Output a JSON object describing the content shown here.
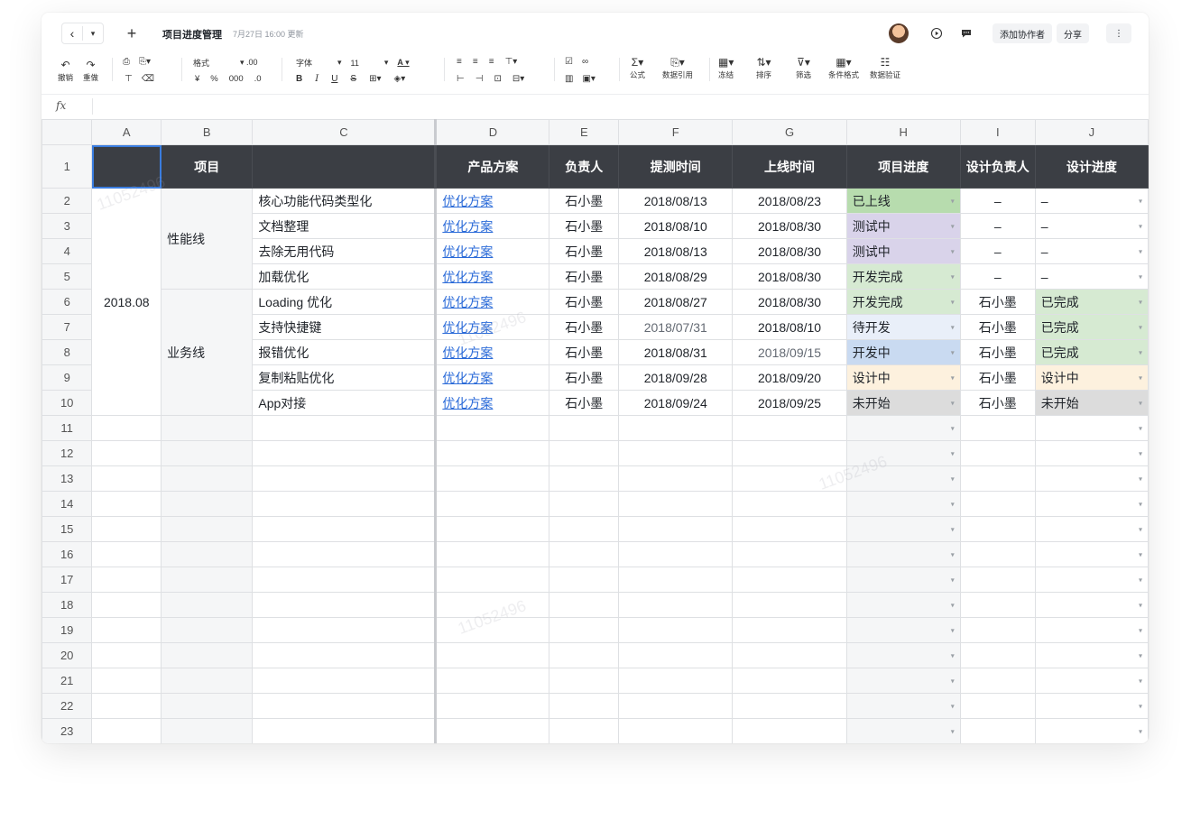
{
  "titlebar": {
    "back_icon": "‹",
    "dropdown_icon": "▾",
    "add_icon": "+",
    "title": "项目进度管理",
    "updated": "7月27日 16:00 更新",
    "add_collaborator": "添加协作者",
    "share": "分享",
    "more_icon": "⋮"
  },
  "toolbar": {
    "undo": "撤销",
    "redo": "重做",
    "format": "格式",
    "font": "字体",
    "font_size": "11",
    "formula": "公式",
    "data_ref": "数据引用",
    "freeze": "冻结",
    "sort": "排序",
    "filter": "筛选",
    "cond_format": "条件格式",
    "data_valid": "数据验证",
    "currency": "¥",
    "percent": "%",
    "thousands": "000"
  },
  "formula_bar": {
    "label": "fx"
  },
  "columns": [
    "A",
    "B",
    "C",
    "D",
    "E",
    "F",
    "G",
    "H",
    "I",
    "J"
  ],
  "header_row": {
    "row_num": "1",
    "b": "项目",
    "d": "产品方案",
    "e": "负责人",
    "f": "提测时间",
    "g": "上线时间",
    "h": "项目进度",
    "i": "设计负责人",
    "j": "设计进度"
  },
  "merged": {
    "month": "2018.08",
    "line1": "性能线",
    "line2": "业务线"
  },
  "rows": [
    {
      "n": "2",
      "task": "核心功能代码类型化",
      "plan": "优化方案",
      "owner": "石小墨",
      "test": "2018/08/13",
      "launch": "2018/08/23",
      "status": "已上线",
      "designer": "–",
      "dstatus": "–"
    },
    {
      "n": "3",
      "task": "文档整理",
      "plan": "优化方案",
      "owner": "石小墨",
      "test": "2018/08/10",
      "launch": "2018/08/30",
      "status": "测试中",
      "designer": "–",
      "dstatus": "–"
    },
    {
      "n": "4",
      "task": "去除无用代码",
      "plan": "优化方案",
      "owner": "石小墨",
      "test": "2018/08/13",
      "launch": "2018/08/30",
      "status": "测试中",
      "designer": "–",
      "dstatus": "–"
    },
    {
      "n": "5",
      "task": "加载优化",
      "plan": "优化方案",
      "owner": "石小墨",
      "test": "2018/08/29",
      "launch": "2018/08/30",
      "status": "开发完成",
      "designer": "–",
      "dstatus": "–"
    },
    {
      "n": "6",
      "task": "Loading 优化",
      "plan": "优化方案",
      "owner": "石小墨",
      "test": "2018/08/27",
      "launch": "2018/08/30",
      "status": "开发完成",
      "designer": "石小墨",
      "dstatus": "已完成"
    },
    {
      "n": "7",
      "task": "支持快捷键",
      "plan": "优化方案",
      "owner": "石小墨",
      "test": "2018/07/31",
      "launch": "2018/08/10",
      "status": "待开发",
      "designer": "石小墨",
      "dstatus": "已完成"
    },
    {
      "n": "8",
      "task": "报错优化",
      "plan": "优化方案",
      "owner": "石小墨",
      "test": "2018/08/31",
      "launch": "2018/09/15",
      "status": "开发中",
      "designer": "石小墨",
      "dstatus": "已完成"
    },
    {
      "n": "9",
      "task": "复制粘贴优化",
      "plan": "优化方案",
      "owner": "石小墨",
      "test": "2018/09/28",
      "launch": "2018/09/20",
      "status": "设计中",
      "designer": "石小墨",
      "dstatus": "设计中"
    },
    {
      "n": "10",
      "task": "App对接",
      "plan": "优化方案",
      "owner": "石小墨",
      "test": "2018/09/24",
      "launch": "2018/09/25",
      "status": "未开始",
      "designer": "石小墨",
      "dstatus": "未开始"
    }
  ],
  "status_colors": {
    "已上线": "#b7dcae",
    "测试中": "#d9d3ea",
    "开发完成": "#d6ead2",
    "待开发": "#e9eff9",
    "开发中": "#c9daf1",
    "设计中": "#fdf1de",
    "未开始": "#dcdcdc",
    "已完成": "#d6ead2"
  },
  "empty_rows": [
    "11",
    "12",
    "13",
    "14",
    "15",
    "16",
    "17",
    "18",
    "19",
    "20",
    "21",
    "22",
    "23"
  ]
}
